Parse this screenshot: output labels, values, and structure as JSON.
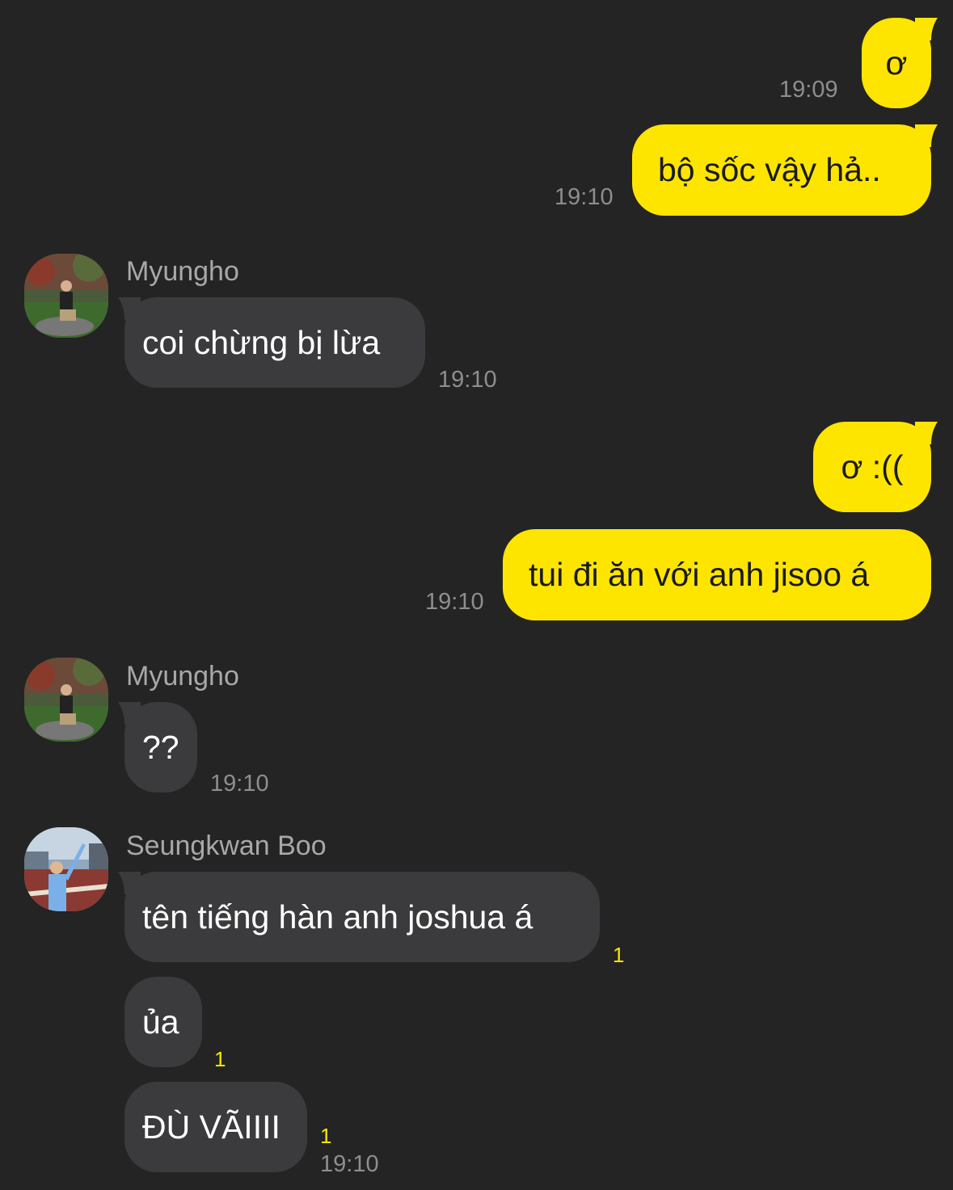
{
  "messages": [
    {
      "text": "ơ",
      "time": "19:09"
    },
    {
      "text": "bộ sốc vậy hả..",
      "time": "19:10"
    },
    {
      "sender": "Myungho",
      "text": "coi chừng bị lừa",
      "time": "19:10",
      "avatar": "avatar-photo-garden"
    },
    {
      "text": "ơ :(("
    },
    {
      "text": "tui đi ăn với anh jisoo á",
      "time": "19:10"
    },
    {
      "sender": "Myungho",
      "text": "??",
      "time": "19:10",
      "avatar": "avatar-photo-garden"
    },
    {
      "sender": "Seungkwan Boo",
      "text": "tên tiếng hàn anh joshua á",
      "unread": "1",
      "avatar": "avatar-photo-city"
    },
    {
      "text": "ủa",
      "unread": "1"
    },
    {
      "text": "ĐÙ VÃIIII",
      "unread": "1",
      "time": "19:10"
    }
  ],
  "colors": {
    "background": "#242424",
    "my_bubble": "#fee500",
    "their_bubble": "#3b3b3d",
    "timestamp": "#8e8e8e",
    "unread_count": "#fee500"
  }
}
